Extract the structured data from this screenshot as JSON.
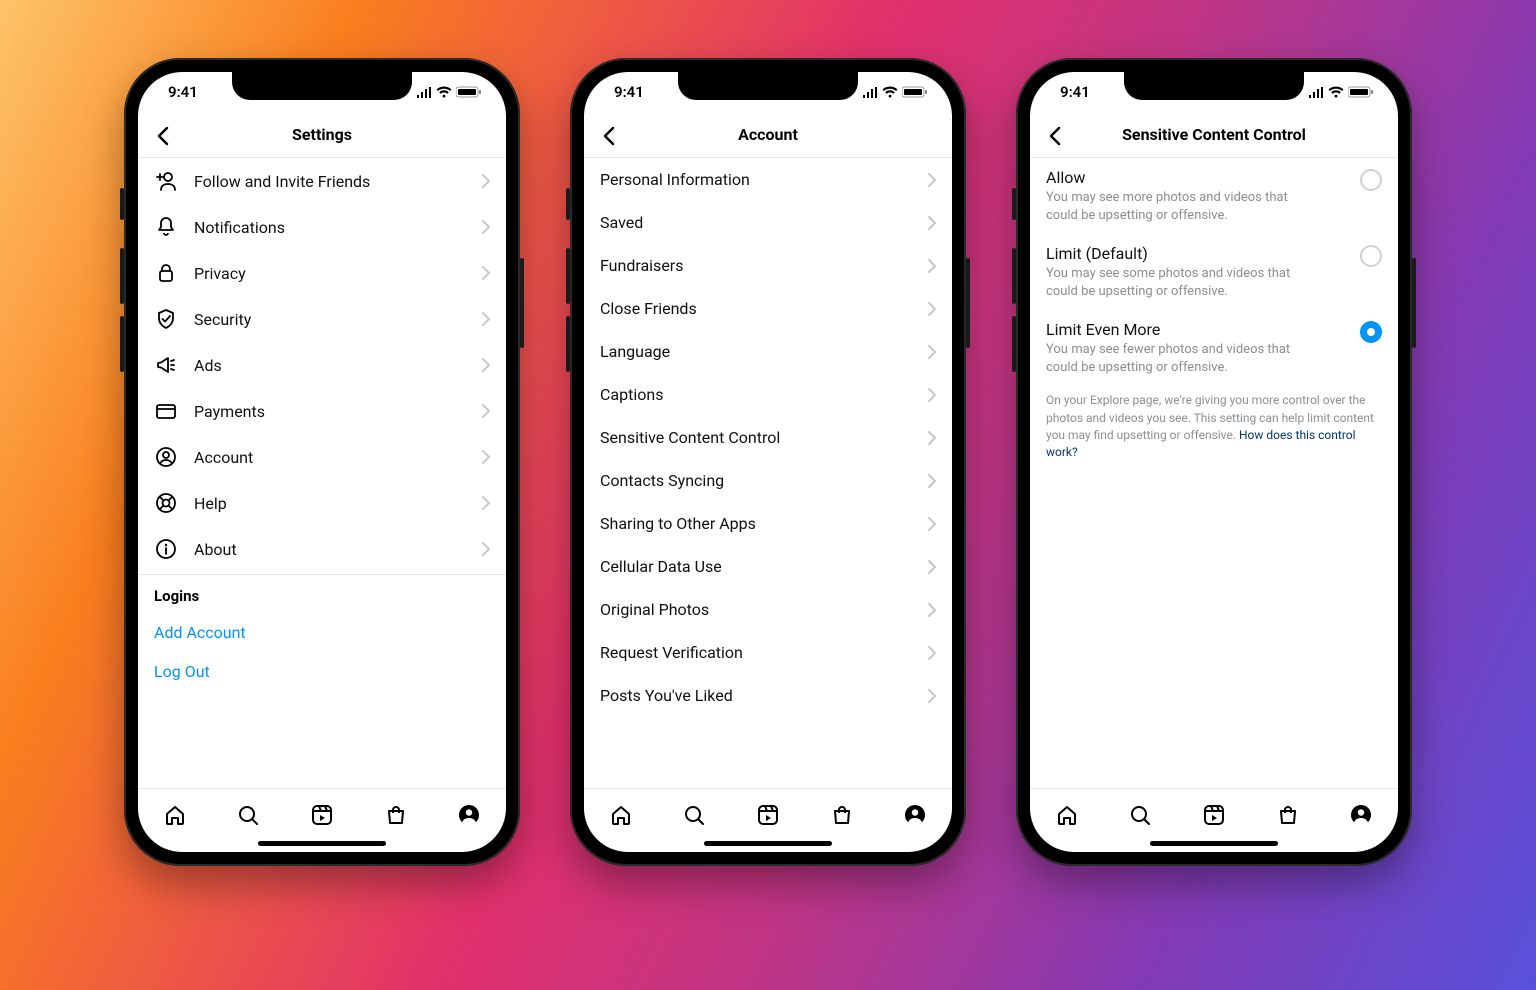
{
  "status": {
    "time": "9:41"
  },
  "phone1": {
    "title": "Settings",
    "items": [
      {
        "icon": "person-plus-icon",
        "label": "Follow and Invite Friends"
      },
      {
        "icon": "bell-icon",
        "label": "Notifications"
      },
      {
        "icon": "lock-icon",
        "label": "Privacy"
      },
      {
        "icon": "shield-icon",
        "label": "Security"
      },
      {
        "icon": "megaphone-icon",
        "label": "Ads"
      },
      {
        "icon": "card-icon",
        "label": "Payments"
      },
      {
        "icon": "person-circle-icon",
        "label": "Account"
      },
      {
        "icon": "help-icon",
        "label": "Help"
      },
      {
        "icon": "info-icon",
        "label": "About"
      }
    ],
    "logins_header": "Logins",
    "add_account": "Add Account",
    "log_out": "Log Out"
  },
  "phone2": {
    "title": "Account",
    "items": [
      "Personal Information",
      "Saved",
      "Fundraisers",
      "Close Friends",
      "Language",
      "Captions",
      "Sensitive Content Control",
      "Contacts Syncing",
      "Sharing to Other Apps",
      "Cellular Data Use",
      "Original Photos",
      "Request Verification",
      "Posts You've Liked"
    ]
  },
  "phone3": {
    "title": "Sensitive Content Control",
    "options": [
      {
        "title": "Allow",
        "sub": "You may see more photos and videos that could be upsetting or offensive.",
        "selected": false
      },
      {
        "title": "Limit (Default)",
        "sub": "You may see some photos and videos that could be upsetting or offensive.",
        "selected": false
      },
      {
        "title": "Limit Even More",
        "sub": "You may see fewer photos and videos that could be upsetting or offensive.",
        "selected": true
      }
    ],
    "footnote_text": "On your Explore page, we're giving you more control over the photos and videos you see. This setting can help limit content you may find upsetting or offensive. ",
    "footnote_link": "How does this control work?"
  }
}
